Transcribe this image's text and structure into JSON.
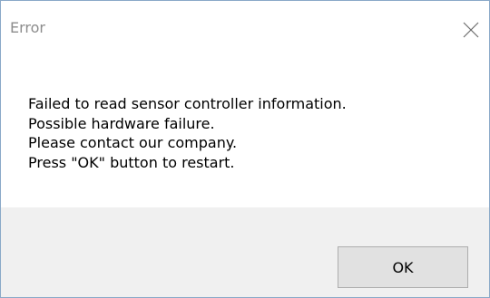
{
  "window": {
    "title": "Error",
    "close_icon": "close-icon"
  },
  "message": {
    "lines": [
      "Failed to read sensor controller information.",
      "Possible hardware failure.",
      "Please contact our company.",
      "Press \"OK\" button to restart."
    ]
  },
  "buttons": {
    "ok_label": "OK"
  },
  "colors": {
    "title_text": "#8c8c8c",
    "border": "#8aa9c8",
    "footer_bg": "#f0f0f0",
    "button_bg": "#e1e1e1",
    "button_border": "#adadad"
  }
}
